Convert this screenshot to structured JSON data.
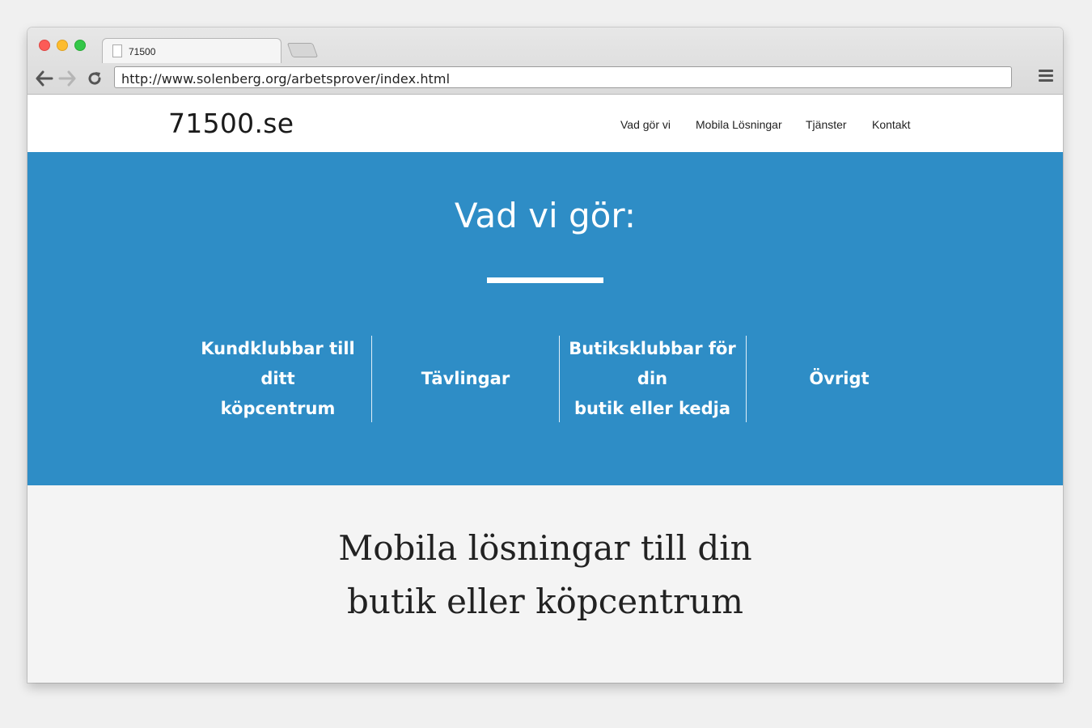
{
  "browser": {
    "tab_title": "71500",
    "url": "http://www.solenberg.org/arbetsprover/index.html",
    "icons": {
      "back": "back-arrow-icon",
      "forward": "forward-arrow-icon",
      "reload": "reload-icon",
      "menu": "hamburger-menu-icon",
      "tab": "document-icon"
    }
  },
  "site": {
    "logo": "71500.se",
    "nav": [
      "Vad gör vi",
      "Mobila Lösningar",
      "Tjänster",
      "Kontakt"
    ]
  },
  "hero": {
    "title": "Vad vi gör:",
    "features": [
      {
        "line1": "Kundklubbar till ditt",
        "line2": "köpcentrum"
      },
      {
        "line1": "Tävlingar",
        "line2": ""
      },
      {
        "line1": "Butiksklubbar för din",
        "line2": "butik eller kedja"
      },
      {
        "line1": "Övrigt",
        "line2": ""
      }
    ]
  },
  "section": {
    "title_line1": "Mobila lösningar till din",
    "title_line2": "butik eller köpcentrum"
  },
  "colors": {
    "hero_background": "#2e8dc6",
    "lower_background": "#f4f4f4",
    "header_background": "#ffffff"
  }
}
